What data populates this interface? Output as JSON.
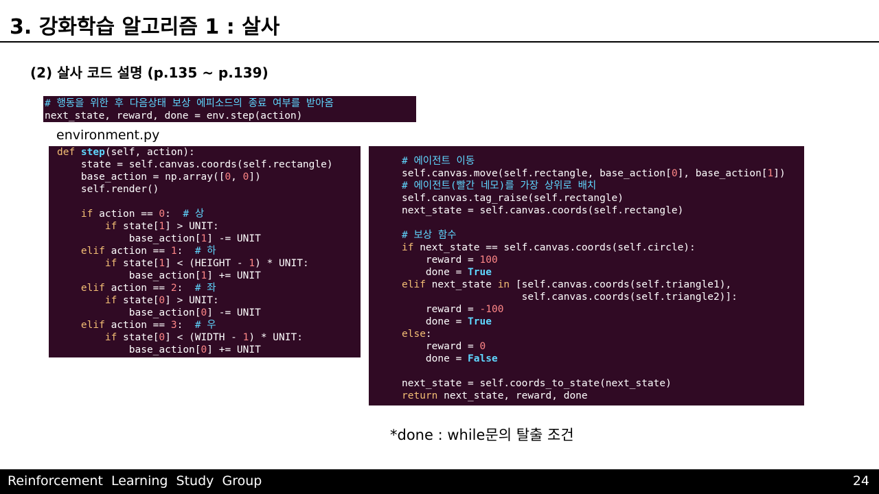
{
  "slide": {
    "title": "3. 강화학습 알고리즘 1 : 살사",
    "subtitle": "(2) 살사 코드 설명 (p.135 ~ p.139)",
    "file_label": "environment.py",
    "note": "*done : while문의 탈출 조건"
  },
  "code_top": {
    "lines": [
      [
        [
          "cm",
          "# 행동을 위한 후 다음상태 보상 에피소드의 종료 여부를 받아옴"
        ]
      ],
      [
        [
          "",
          "next_state, reward, done = env.step(action)"
        ]
      ]
    ]
  },
  "code_left": {
    "lines": [
      [
        [
          "kw",
          "def "
        ],
        [
          "fn",
          "step"
        ],
        [
          "",
          "(self, action):"
        ]
      ],
      [
        [
          "",
          "    state = self.canvas.coords(self.rectangle)"
        ]
      ],
      [
        [
          "",
          "    base_action = np.array(["
        ],
        [
          "num",
          "0"
        ],
        [
          "",
          ", "
        ],
        [
          "num",
          "0"
        ],
        [
          "",
          "])"
        ]
      ],
      [
        [
          "",
          "    self.render()"
        ]
      ],
      [
        [
          "",
          ""
        ]
      ],
      [
        [
          "",
          "    "
        ],
        [
          "kw",
          "if"
        ],
        [
          "",
          " action == "
        ],
        [
          "num",
          "0"
        ],
        [
          "",
          ":  "
        ],
        [
          "cm",
          "# 상"
        ]
      ],
      [
        [
          "",
          "        "
        ],
        [
          "kw",
          "if"
        ],
        [
          "",
          " state["
        ],
        [
          "num",
          "1"
        ],
        [
          "",
          "] > UNIT:"
        ]
      ],
      [
        [
          "",
          "            base_action["
        ],
        [
          "num",
          "1"
        ],
        [
          "",
          "] -= UNIT"
        ]
      ],
      [
        [
          "",
          "    "
        ],
        [
          "kw",
          "elif"
        ],
        [
          "",
          " action == "
        ],
        [
          "num",
          "1"
        ],
        [
          "",
          ":  "
        ],
        [
          "cm",
          "# 하"
        ]
      ],
      [
        [
          "",
          "        "
        ],
        [
          "kw",
          "if"
        ],
        [
          "",
          " state["
        ],
        [
          "num",
          "1"
        ],
        [
          "",
          "] < (HEIGHT - "
        ],
        [
          "num",
          "1"
        ],
        [
          "",
          ") * UNIT:"
        ]
      ],
      [
        [
          "",
          "            base_action["
        ],
        [
          "num",
          "1"
        ],
        [
          "",
          "] += UNIT"
        ]
      ],
      [
        [
          "",
          "    "
        ],
        [
          "kw",
          "elif"
        ],
        [
          "",
          " action == "
        ],
        [
          "num",
          "2"
        ],
        [
          "",
          ":  "
        ],
        [
          "cm",
          "# 좌"
        ]
      ],
      [
        [
          "",
          "        "
        ],
        [
          "kw",
          "if"
        ],
        [
          "",
          " state["
        ],
        [
          "num",
          "0"
        ],
        [
          "",
          "] > UNIT:"
        ]
      ],
      [
        [
          "",
          "            base_action["
        ],
        [
          "num",
          "0"
        ],
        [
          "",
          "] -= UNIT"
        ]
      ],
      [
        [
          "",
          "    "
        ],
        [
          "kw",
          "elif"
        ],
        [
          "",
          " action == "
        ],
        [
          "num",
          "3"
        ],
        [
          "",
          ":  "
        ],
        [
          "cm",
          "# 우"
        ]
      ],
      [
        [
          "",
          "        "
        ],
        [
          "kw",
          "if"
        ],
        [
          "",
          " state["
        ],
        [
          "num",
          "0"
        ],
        [
          "",
          "] < (WIDTH - "
        ],
        [
          "num",
          "1"
        ],
        [
          "",
          ") * UNIT:"
        ]
      ],
      [
        [
          "",
          "            base_action["
        ],
        [
          "num",
          "0"
        ],
        [
          "",
          "] += UNIT"
        ]
      ]
    ]
  },
  "code_right": {
    "lines": [
      [
        [
          "cm",
          "# 에이전트 이동"
        ]
      ],
      [
        [
          "",
          "self.canvas.move(self.rectangle, base_action["
        ],
        [
          "num",
          "0"
        ],
        [
          "",
          "], base_action["
        ],
        [
          "num",
          "1"
        ],
        [
          "",
          "])"
        ]
      ],
      [
        [
          "cm",
          "# 에이전트(빨간 네모)를 가장 상위로 배치"
        ]
      ],
      [
        [
          "",
          "self.canvas.tag_raise(self.rectangle)"
        ]
      ],
      [
        [
          "",
          "next_state = self.canvas.coords(self.rectangle)"
        ]
      ],
      [
        [
          "",
          ""
        ]
      ],
      [
        [
          "cm",
          "# 보상 함수"
        ]
      ],
      [
        [
          "kw",
          "if"
        ],
        [
          "",
          " next_state == self.canvas.coords(self.circle):"
        ]
      ],
      [
        [
          "",
          "    reward = "
        ],
        [
          "num",
          "100"
        ]
      ],
      [
        [
          "",
          "    done = "
        ],
        [
          "bool",
          "True"
        ]
      ],
      [
        [
          "kw",
          "elif"
        ],
        [
          "",
          " next_state "
        ],
        [
          "kw",
          "in"
        ],
        [
          "",
          " [self.canvas.coords(self.triangle1),"
        ]
      ],
      [
        [
          "",
          "                    self.canvas.coords(self.triangle2)]:"
        ]
      ],
      [
        [
          "",
          "    reward = "
        ],
        [
          "num",
          "-100"
        ]
      ],
      [
        [
          "",
          "    done = "
        ],
        [
          "bool",
          "True"
        ]
      ],
      [
        [
          "kw",
          "else"
        ],
        [
          "",
          ":"
        ]
      ],
      [
        [
          "",
          "    reward = "
        ],
        [
          "num",
          "0"
        ]
      ],
      [
        [
          "",
          "    done = "
        ],
        [
          "bool",
          "False"
        ]
      ],
      [
        [
          "",
          ""
        ]
      ],
      [
        [
          "",
          "next_state = self.coords_to_state(next_state)"
        ]
      ],
      [
        [
          "kw",
          "return"
        ],
        [
          "",
          " next_state, reward, done"
        ]
      ]
    ]
  },
  "footer": {
    "group_name": "Reinforcement  Learning  Study  Group",
    "page_number": "24"
  },
  "colors": {
    "code_background": "#300a24",
    "keyword": "#f4bf75",
    "number": "#ff8787",
    "comment": "#5fd7ff"
  }
}
